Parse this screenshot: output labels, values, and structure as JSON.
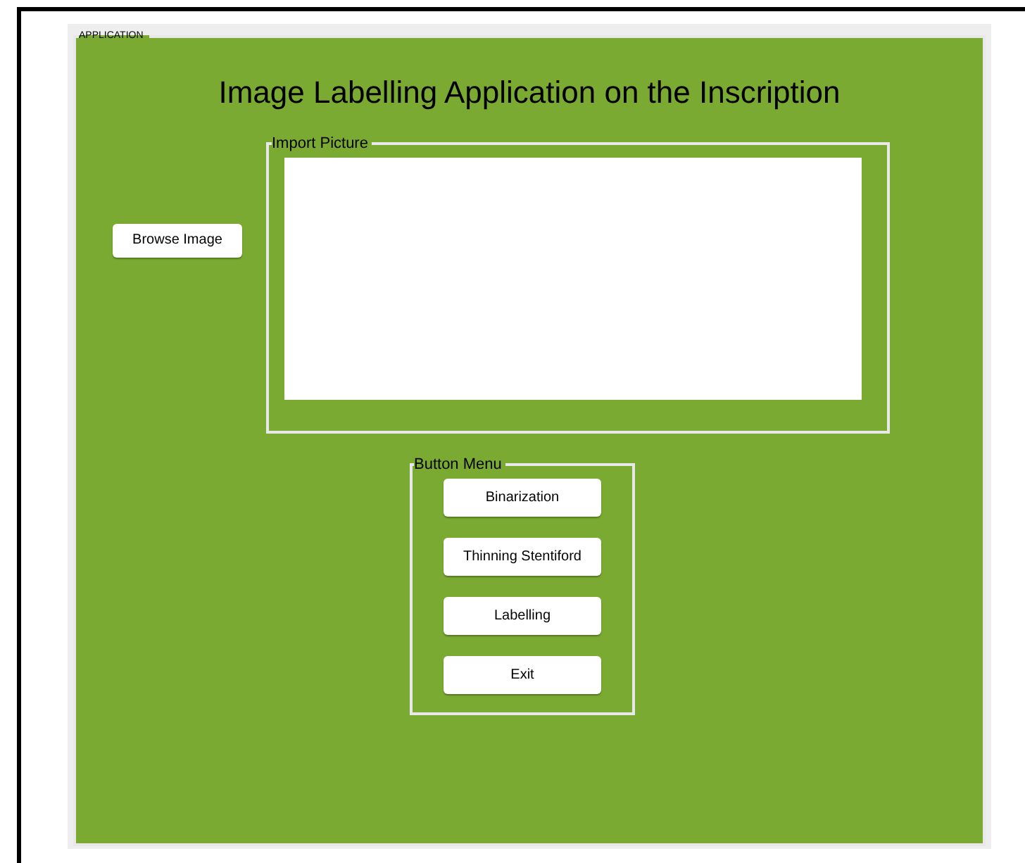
{
  "panel": {
    "title": "APPLICATION"
  },
  "heading": "Image Labelling Application on the Inscription",
  "browse_button": "Browse Image",
  "import_group": {
    "title": "Import Picture"
  },
  "menu_group": {
    "title": "Button Menu",
    "buttons": [
      "Binarization",
      "Thinning Stentiford",
      "Labelling",
      "Exit"
    ]
  }
}
